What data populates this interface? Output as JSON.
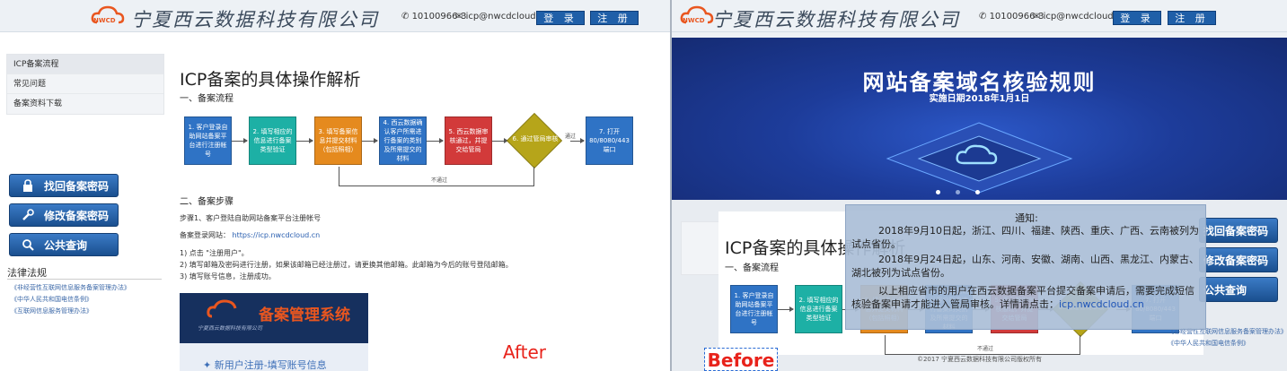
{
  "header": {
    "brand": "宁夏西云数据科技有限公司",
    "logo_text": "NWCD",
    "phone": "10100966-3",
    "email": "icp@nwcdcloud.cn",
    "login": "登 录",
    "register": "注 册"
  },
  "sidebar": {
    "items": [
      {
        "label": "ICP备案流程"
      },
      {
        "label": "常见问题"
      },
      {
        "label": "备案资料下载"
      }
    ],
    "buttons": [
      {
        "label": "找回备案密码",
        "icon": "lock-icon"
      },
      {
        "label": "修改备案密码",
        "icon": "wrench-icon"
      },
      {
        "label": "公共查询",
        "icon": "search-icon"
      }
    ],
    "law_title": "法律法规",
    "law_links": [
      "《非经营性互联网信息服务备案管理办法》",
      "《中华人民共和国电信条例》",
      "《互联网信息服务管理办法》"
    ]
  },
  "main": {
    "title": "ICP备案的具体操作解析",
    "section1": "一、备案流程",
    "flow": [
      {
        "label": "1. 客户登录自助网站备案平台进行注册帐号",
        "color": "#2f73c5"
      },
      {
        "label": "2. 填写相应的信息进行备案类型验证",
        "color": "#1db0a5"
      },
      {
        "label": "3. 填写备案信息并提交材料（包括照相）",
        "color": "#e58a1e"
      },
      {
        "label": "4. 西云数据确认客户所需进行备案的类别及所需提交的材料",
        "color": "#2f73c5"
      },
      {
        "label": "5. 西云数据审核通过，并提交给管局",
        "color": "#d23a3a"
      },
      {
        "label": "6. 通过管局审核",
        "color": "#b6a51a"
      },
      {
        "label": "7. 打开80/8080/443端口",
        "color": "#2f73c5"
      }
    ],
    "flow_pass": "通过",
    "flow_fail": "不通过",
    "section2": "二、备案步骤",
    "step1": "步骤1、客户登陆自助网站备案平台注册帐号",
    "site_label": "备案登录网站：",
    "site_url": "https://icp.nwcdcloud.cn",
    "instructions": [
      "1) 点击 \"注册用户\"。",
      "2) 填写邮箱及密码进行注册，如果该邮箱已经注册过，请更换其他邮箱。此邮箱为今后的账号登陆邮箱。",
      "3) 填写账号信息，注册成功。"
    ],
    "system_title": "备案管理系统",
    "system_sub": "宁夏西云数据科技有限公司",
    "system_register": "新用户注册-填写账号信息"
  },
  "labels": {
    "after": "After",
    "before": "Before"
  },
  "banner": {
    "title": "网站备案域名核验规则",
    "subtitle": "实施日期2018年1月1日"
  },
  "notice": {
    "title": "通知:",
    "p1": "2018年9月10日起，浙江、四川、福建、陕西、重庆、广西、云南被列为试点省份。",
    "p2": "2018年9月24日起，山东、河南、安徽、湖南、山西、黑龙江、内蒙古、湖北被列为试点省份。",
    "p3": "以上相应省市的用户在西云数据备案平台提交备案申请后，需要完成短信核验备案申请才能进入管局审核。详情请点击：",
    "link": "icp.nwcdcloud.cn"
  },
  "right_buttons": [
    "找回备案密码",
    "修改备案密码",
    "公共查询"
  ],
  "right_links": [
    "《非经营性互联网信息服务备案管理办法》",
    "《中华人民共和国电信条例》"
  ],
  "footer": "©2017 宁夏西云数据科技有限公司版权所有"
}
